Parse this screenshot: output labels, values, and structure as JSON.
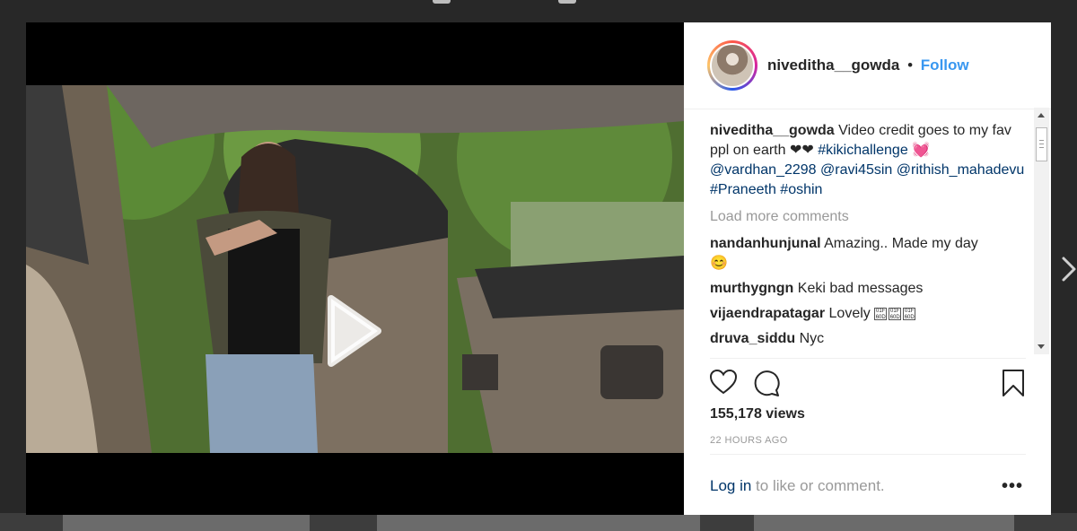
{
  "post": {
    "username": "niveditha__gowda",
    "separator": "•",
    "follow_label": "Follow"
  },
  "caption": {
    "username": "niveditha__gowda",
    "text": "Video credit goes to my fav ppl on earth ❤❤ ",
    "hashtag1": "#kikichallenge",
    "emoji": "💓",
    "mention1": "@vardhan_2298",
    "mention2": "@ravi45sin",
    "mention3": "@rithish_mahadevu",
    "hashtag2": "#Praneeth",
    "hashtag3": "#oshin"
  },
  "load_more_label": "Load more comments",
  "comments": [
    {
      "user": "nandanhunjunal",
      "text": "Amazing.. Made my day",
      "emoji": "😊"
    },
    {
      "user": "murthygngn",
      "text": "Keki bad messages"
    },
    {
      "user": "vijaendrapatagar",
      "text": "Lovely",
      "glyph": "01F 60D"
    },
    {
      "user": "druva_siddu",
      "text": "Nyc"
    }
  ],
  "views": "155,178 views",
  "time": "22 HOURS AGO",
  "footer": {
    "login_link": "Log in",
    "login_text": " to like or comment.",
    "more": "•••"
  },
  "icons": {
    "like": "heart-icon",
    "comment": "comment-icon",
    "save": "bookmark-icon",
    "play": "play-icon",
    "next": "chevron-right-icon"
  },
  "colors": {
    "link_blue": "#3897f0",
    "hashtag_blue": "#003569",
    "text": "#262626",
    "muted": "#999999"
  }
}
